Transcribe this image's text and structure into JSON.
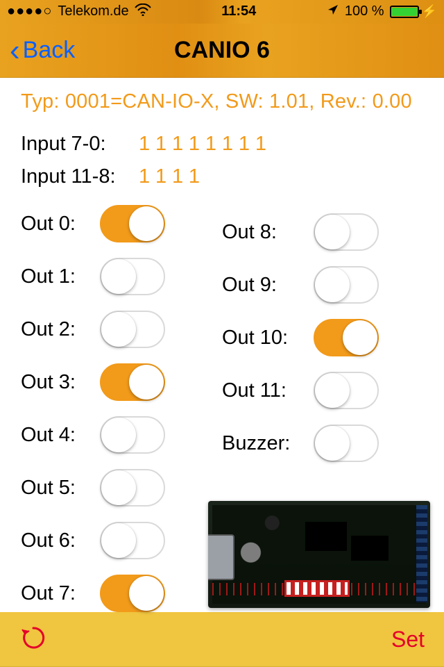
{
  "status": {
    "signal_dots": "●●●●○",
    "carrier": "Telekom.de",
    "time": "11:54",
    "battery_pct": "100 %"
  },
  "nav": {
    "back": "Back",
    "title": "CANIO 6"
  },
  "info": {
    "typ_line": "Typ: 0001=CAN-IO-X, SW: 1.01, Rev.: 0.00",
    "input70_label": "Input 7-0:",
    "input70_bits": "11111111",
    "input118_label": "Input 11-8:",
    "input118_bits": "1111"
  },
  "outs_left": [
    {
      "label": "Out 0:",
      "on": true
    },
    {
      "label": "Out 1:",
      "on": false
    },
    {
      "label": "Out 2:",
      "on": false
    },
    {
      "label": "Out 3:",
      "on": true
    },
    {
      "label": "Out 4:",
      "on": false
    },
    {
      "label": "Out 5:",
      "on": false
    },
    {
      "label": "Out 6:",
      "on": false
    },
    {
      "label": "Out 7:",
      "on": true
    }
  ],
  "outs_right": [
    {
      "label": "Out 8:",
      "on": false
    },
    {
      "label": "Out 9:",
      "on": false
    },
    {
      "label": "Out 10:",
      "on": true
    },
    {
      "label": "Out 11:",
      "on": false
    },
    {
      "label": "Buzzer:",
      "on": false
    }
  ],
  "toolbar": {
    "set": "Set"
  }
}
